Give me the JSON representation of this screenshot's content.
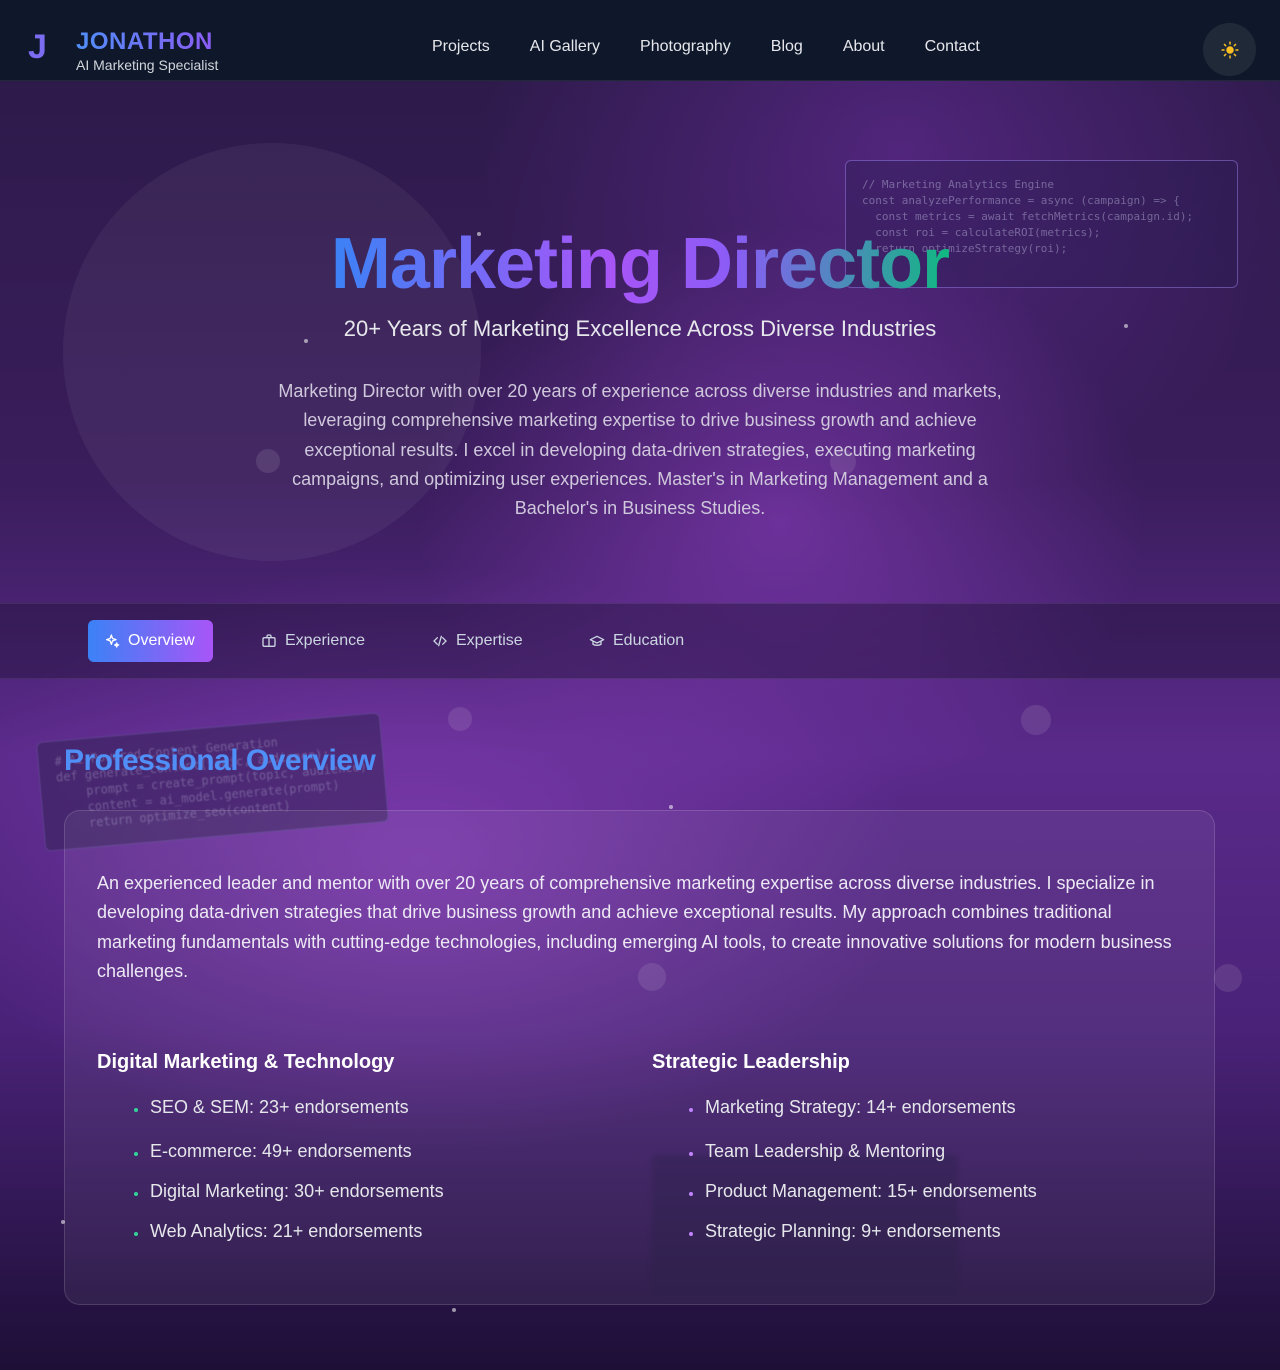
{
  "header": {
    "logo_letter": "J",
    "brand_name": "JONATHON",
    "brand_tagline": "AI Marketing Specialist",
    "nav": [
      "Projects",
      "AI Gallery",
      "Photography",
      "Blog",
      "About",
      "Contact"
    ],
    "theme_icon": "sun-icon"
  },
  "hero": {
    "title": "Marketing Director",
    "subtitle": "20+ Years of Marketing Excellence Across Diverse Industries",
    "description": "Marketing Director with over 20 years of experience across diverse industries and markets, leveraging comprehensive marketing expertise to drive business growth and achieve exceptional results. I excel in developing data-driven strategies, executing marketing campaigns, and optimizing user experiences. Master's in Marketing Management and a Bachelor's in Business Studies.",
    "code_snippet": "// Marketing Analytics Engine\nconst analyzePerformance = async (campaign) => {\n  const metrics = await fetchMetrics(campaign.id);\n  const roi = calculateROI(metrics);\n  return optimizeStrategy(roi);"
  },
  "tabs": [
    {
      "label": "Overview",
      "icon": "sparkles-icon",
      "active": true
    },
    {
      "label": "Experience",
      "icon": "briefcase-icon",
      "active": false
    },
    {
      "label": "Expertise",
      "icon": "code-icon",
      "active": false
    },
    {
      "label": "Education",
      "icon": "graduation-cap-icon",
      "active": false
    }
  ],
  "overview": {
    "title": "Professional Overview",
    "code_snippet": "# AI-Powered Content Generation\ndef generate_content(topic, audience):\n    prompt = create_prompt(topic, audience)\n    content = ai_model.generate(prompt)\n    return optimize_seo(content)",
    "intro": "An experienced leader and mentor with over 20 years of comprehensive marketing expertise across diverse industries. I specialize in developing data-driven strategies that drive business growth and achieve exceptional results. My approach combines traditional marketing fundamentals with cutting-edge technologies, including emerging AI tools, to create innovative solutions for modern business challenges.",
    "columns": [
      {
        "title": "Digital Marketing & Technology",
        "items": [
          "SEO & SEM: 23+ endorsements",
          "E-commerce: 49+ endorsements",
          "Digital Marketing: 30+ endorsements",
          "Web Analytics: 21+ endorsements"
        ]
      },
      {
        "title": "Strategic Leadership",
        "items": [
          "Marketing Strategy: 14+ endorsements",
          "Team Leadership & Mentoring",
          "Product Management: 15+ endorsements",
          "Strategic Planning: 9+ endorsements"
        ]
      }
    ]
  },
  "colors": {
    "accent_blue": "#3b82f6",
    "accent_purple": "#a855f7",
    "accent_green": "#10b981",
    "header_bg": "#0f172a"
  }
}
